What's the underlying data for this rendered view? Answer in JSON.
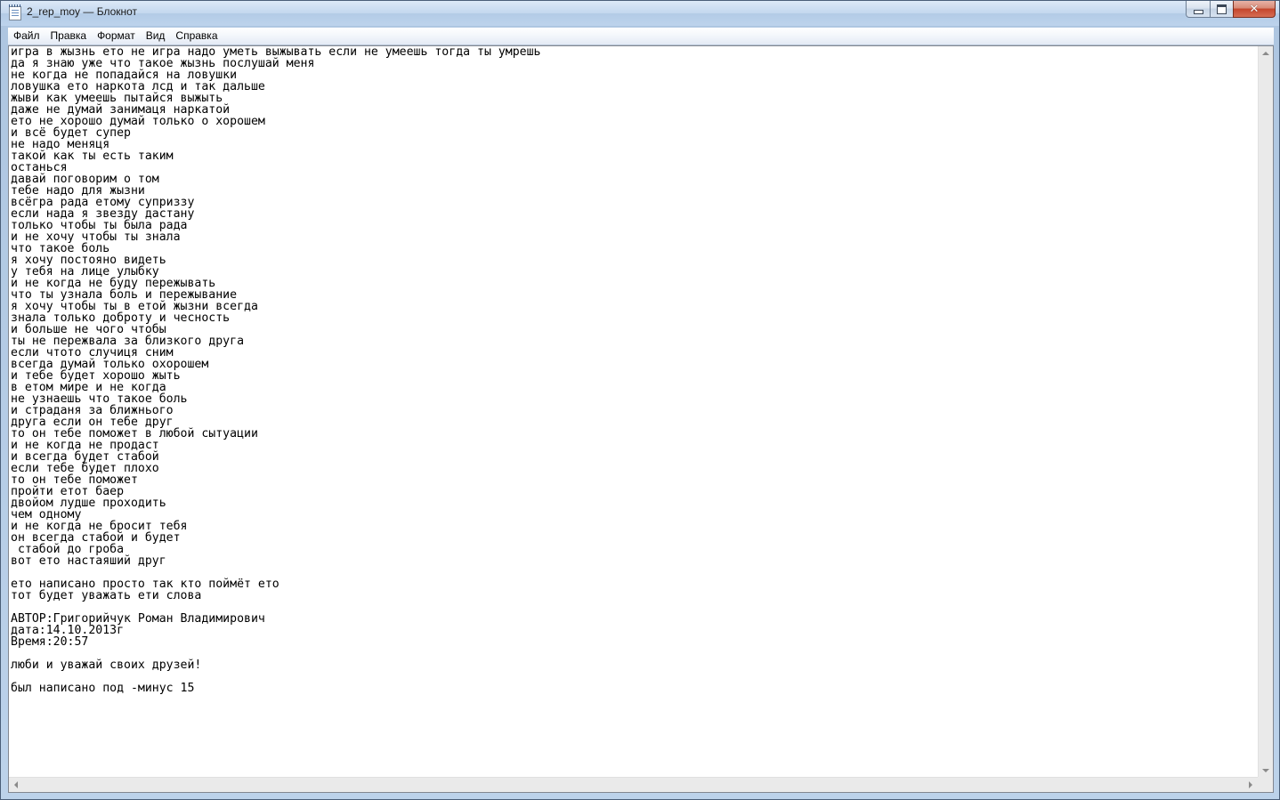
{
  "window": {
    "title": "2_rep_moy — Блокнот",
    "controls": {
      "minimize_icon": "minimize-icon",
      "maximize_icon": "maximize-icon",
      "close_icon": "close-icon",
      "close_glyph": "✕"
    }
  },
  "menu": {
    "file": "Файл",
    "edit": "Правка",
    "format": "Формат",
    "view": "Вид",
    "help": "Справка"
  },
  "document": {
    "text": "игра в жызнь ето не игра надо уметь выжывать если не умеешь тогда ты умрешь\nда я знаю уже что такое жызнь послушай меня\nне когда не попадайся на ловушки\nловушка ето наркота лсд и так дальше\nжыви как умеешь пытайся выжыть\nдаже не думай занимаця наркатой\nето не хорошо думай только о хорошем\nи всё будет супер\nне надо меняця\nтакой как ты есть таким\nостанься\nдавай поговорим о том\nтебе надо для жызни\nвсёгра рада етому суприззу\nесли нада я звезду дастану\nтолько чтобы ты была рада\nи не хочу чтобы ты знала\nчто такое боль\nя хочу постояно видеть\nу тебя на лице улыбку\nи не когда не буду пережывать\nчто ты узнала боль и пережывание\nя хочу чтобы ты в етой жызни всегда\nзнала только доброту и чесность\nи больше не чого чтобы\nты не пережвала за близкого друга\nесли чтото случиця сним\nвсегда думай только охорошем\nи тебе будет хорошо жыть\nв етом мире и не когда\nне узнаешь что такое боль\nи страданя за ближнього\nдруга если он тебе друг\nто он тебе поможет в любой сытуации\nи не когда не продаст\nи всегда будет стабой\nесли тебе будет плохо\nто он тебе поможет\nпройти етот баер\nдвойом лудше проходить\nчем одному\nи не когда не бросит тебя\nон всегда стабой и будет\n стабой до гроба\nвот ето настаяший друг\n\nето написано просто так кто поймёт ето\nтот будет уважать ети слова\n\nАВТОР:Григорийчук Роман Владимирович\nдата:14.10.2013г\nВремя:20:57\n\nлюби и уважай своих друзей!\n\nбыл написано под -минус 15"
  },
  "scrollbars": {
    "up_icon": "scroll-up-icon",
    "down_icon": "scroll-down-icon",
    "left_icon": "scroll-left-icon",
    "right_icon": "scroll-right-icon"
  },
  "colors": {
    "window_frame": "#b7cde6",
    "close_button": "#c4452c",
    "editor_bg": "#ffffff",
    "text": "#000000"
  }
}
